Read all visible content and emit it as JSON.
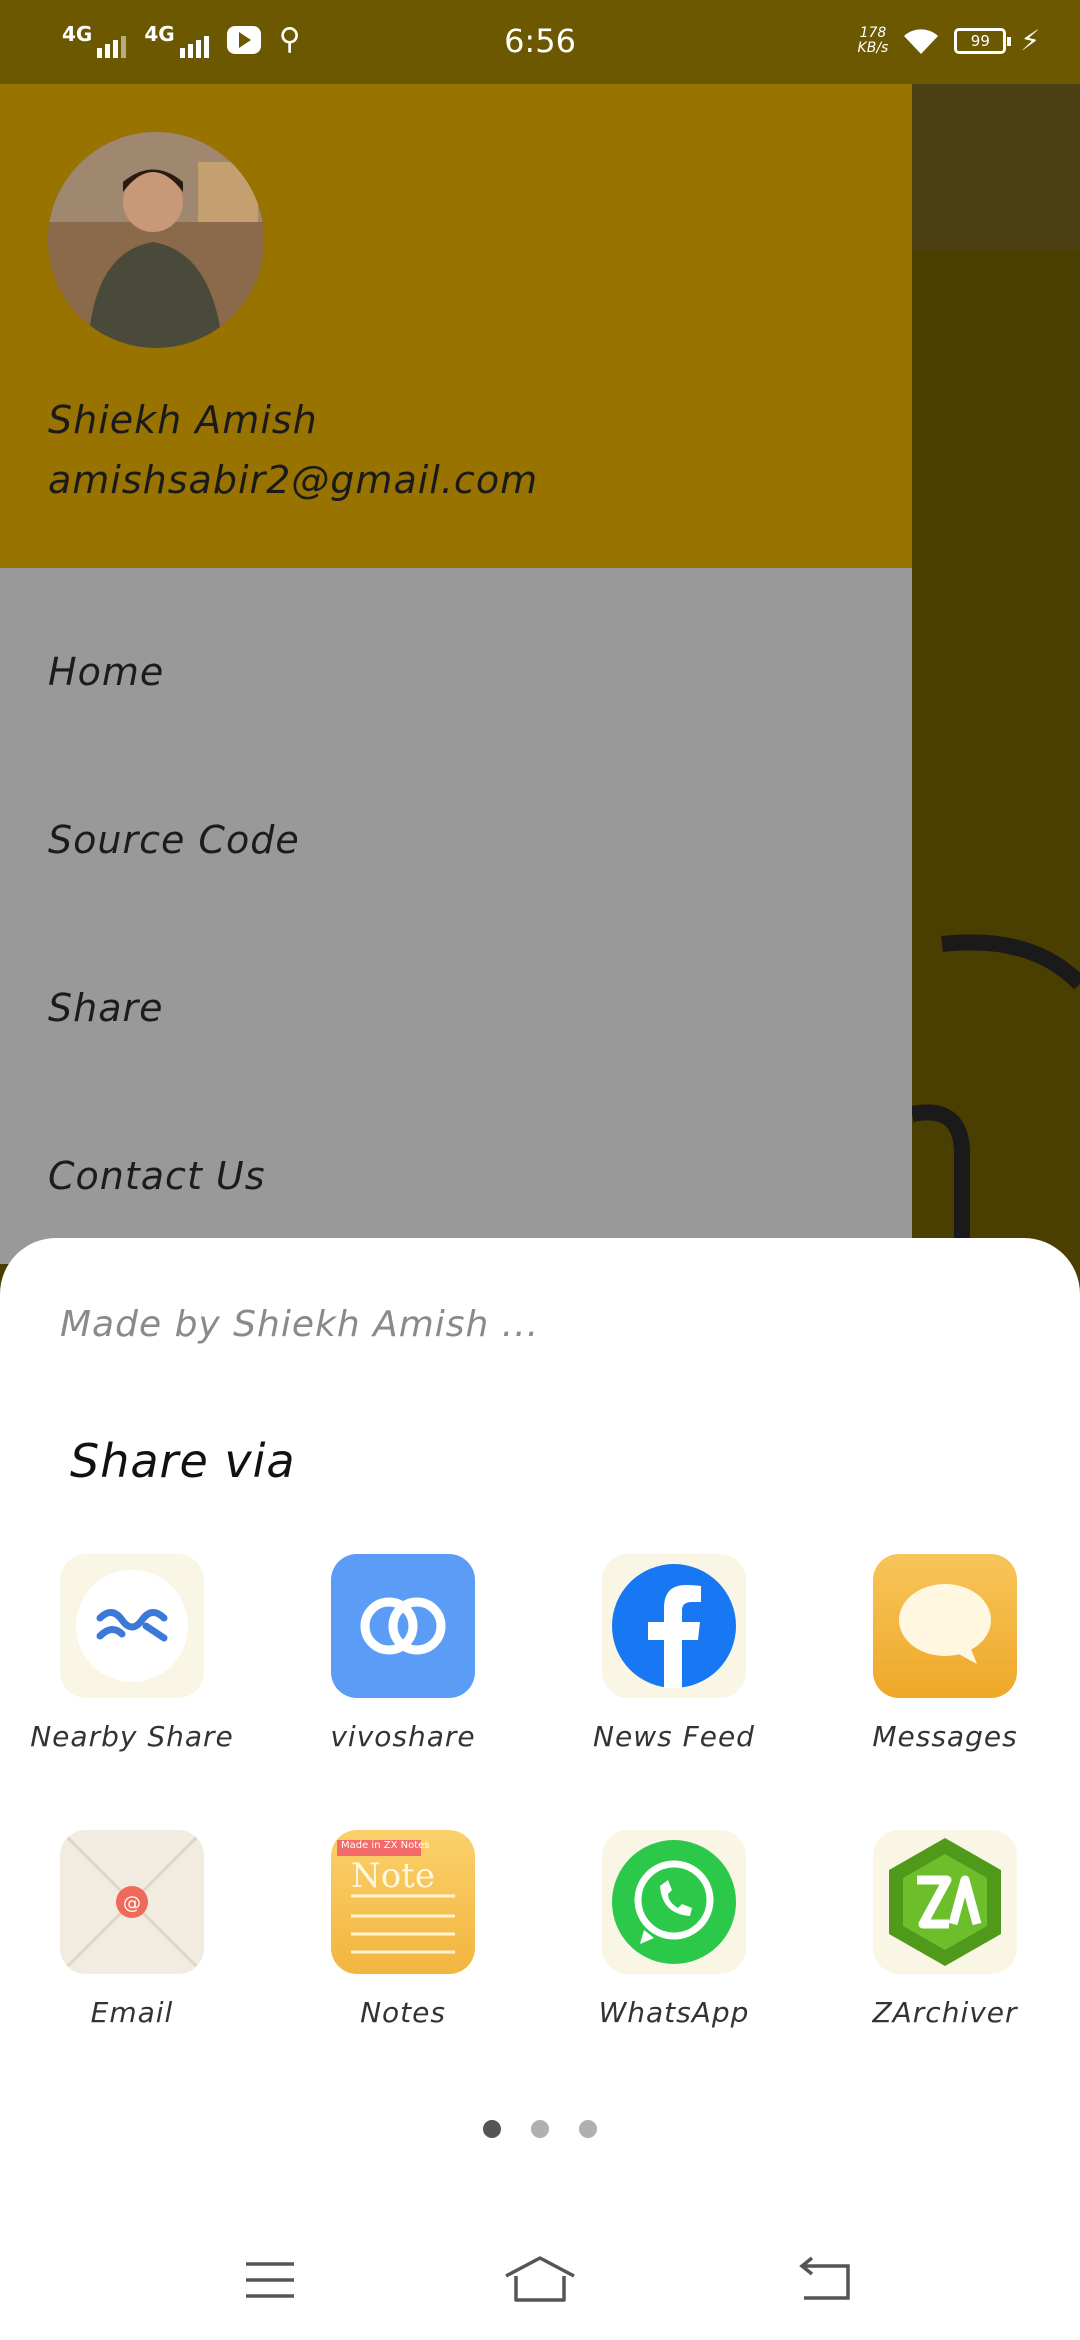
{
  "status_bar": {
    "time": "6:56",
    "network_1": "4G",
    "network_2": "4G",
    "speed_value": "178",
    "speed_unit": "KB/s",
    "battery": "99",
    "icons": [
      "signal-icon",
      "youtube-icon",
      "usb-icon",
      "wifi-icon",
      "battery-icon",
      "charging-icon"
    ]
  },
  "drawer": {
    "user": {
      "name": "Shiekh Amish",
      "email": "amishsabir2@gmail.com"
    },
    "menu": [
      {
        "label": "Home"
      },
      {
        "label": "Source Code"
      },
      {
        "label": "Share"
      },
      {
        "label": "Contact Us"
      }
    ]
  },
  "share_sheet": {
    "subtitle": "Made by Shiekh Amish ...",
    "title": "Share via",
    "apps": [
      {
        "label": "Nearby Share",
        "icon": "nearby-share-icon"
      },
      {
        "label": "vivoshare",
        "icon": "vivoshare-icon"
      },
      {
        "label": "News Feed",
        "icon": "facebook-icon"
      },
      {
        "label": "Messages",
        "icon": "messages-icon"
      },
      {
        "label": "Email",
        "icon": "email-icon"
      },
      {
        "label": "Notes",
        "icon": "notes-icon"
      },
      {
        "label": "WhatsApp",
        "icon": "whatsapp-icon"
      },
      {
        "label": "ZArchiver",
        "icon": "zarchiver-icon"
      }
    ],
    "notes_icon_text": "Note",
    "notes_ribbon_text": "Made in ZX Notes",
    "page_count": 3,
    "current_page": 1
  },
  "colors": {
    "drawer_header": "#997300",
    "status_bar": "#6b5800",
    "drawer_body": "#999999"
  }
}
